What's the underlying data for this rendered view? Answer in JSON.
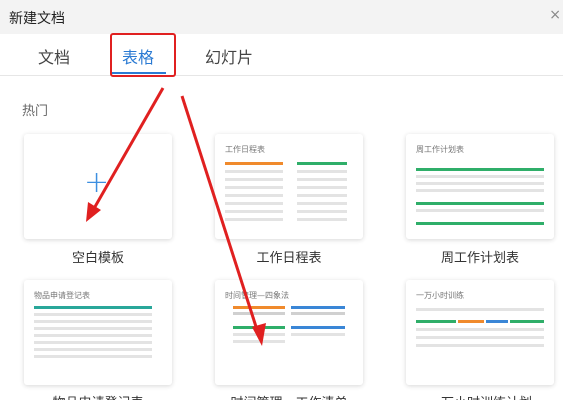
{
  "window": {
    "title": "新建文档",
    "close_label": "×"
  },
  "tabs": [
    {
      "label": "文档",
      "active": false
    },
    {
      "label": "表格",
      "active": true
    },
    {
      "label": "幻灯片",
      "active": false
    }
  ],
  "section_title": "热门",
  "templates": [
    {
      "label": "空白模板",
      "thumb_title": ""
    },
    {
      "label": "工作日程表",
      "thumb_title": "工作日程表"
    },
    {
      "label": "周工作计划表",
      "thumb_title": "周工作计划表"
    },
    {
      "label": "物品申请登记表",
      "thumb_title": "物品申请登记表"
    },
    {
      "label": "时间管理－工作清单",
      "thumb_title": "时间管理—四象法"
    },
    {
      "label": "一万小时训练计划",
      "thumb_title": "一万小时训练"
    }
  ],
  "colors": {
    "accent": "#2a7ad3",
    "annotation": "#e02020",
    "plus": "#3d8fe0"
  }
}
